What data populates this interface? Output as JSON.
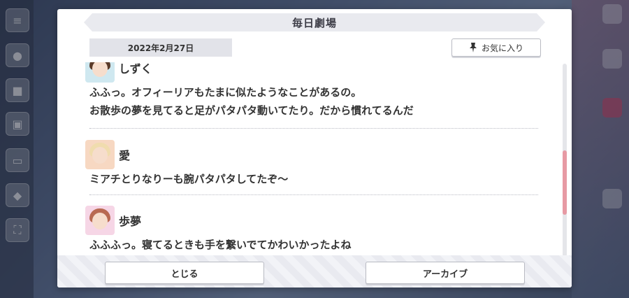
{
  "dialog": {
    "title": "毎日劇場",
    "date": "2022年2月27日",
    "favorite_label": "お気に入り",
    "close_label": "とじる",
    "archive_label": "アーカイブ"
  },
  "entries": [
    {
      "speaker": "しずく",
      "lines": [
        "ふふっ。オフィーリアもたまに似たようなことがあるの。",
        "お散歩の夢を見てると足がパタパタ動いてたり。だから慣れてるんだ"
      ]
    },
    {
      "speaker": "愛",
      "lines": [
        "ミアチとりなりーも腕パタパタしてたぞ〜"
      ]
    },
    {
      "speaker": "歩夢",
      "lines": [
        "ふふふっ。寝てるときも手を繋いでてかわいかったよね"
      ]
    }
  ],
  "colors": {
    "accent_scroll": "#e79aa4",
    "title_bar": "#e9eaef"
  },
  "icons": {
    "favorite": "pin-icon"
  }
}
